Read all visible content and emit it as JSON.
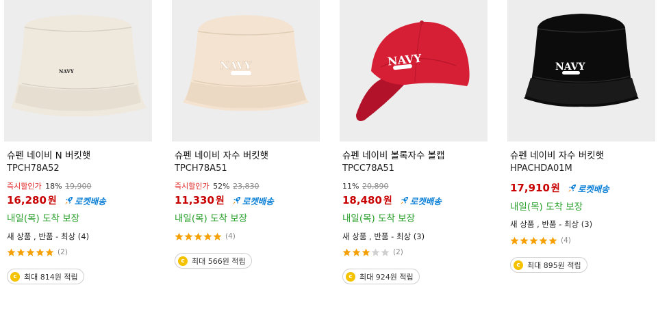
{
  "colors": {
    "discount_red": "#e02020",
    "price_red": "#c80000",
    "rocket_blue": "#0a7fd6",
    "delivery_green": "#28a02a",
    "star_orange": "#f5a000",
    "coin_yellow": "#f5c200"
  },
  "common": {
    "rocket_label": "로켓배송",
    "delivery_text": "내일(목) 도착 보장",
    "coin_symbol": "c",
    "discount_label": "즉시할인가",
    "price_unit": "원"
  },
  "products": [
    {
      "image_icon": "bucket-hat-cream-icon",
      "title": "슈펜 네이비 N 버킷햇",
      "code": "TPCH78A52",
      "discount_rate": "18%",
      "original_price": "19,900",
      "price": "16,280",
      "condition": "새 상품 , 반품 - 최상 (4)",
      "rating": 5,
      "rating_count": "(2)",
      "reward": "최대 814원 적립"
    },
    {
      "image_icon": "bucket-hat-beige-icon",
      "title": "슈펜 네이비 자수 버킷햇",
      "code": "TPCH78A51",
      "discount_rate": "52%",
      "original_price": "23,830",
      "price": "11,330",
      "rating": 5,
      "rating_count": "(4)",
      "reward": "최대 566원 적립"
    },
    {
      "image_icon": "ball-cap-red-icon",
      "title": "슈펜 네이비 볼록자수 볼캡",
      "code": "TPCC78A51",
      "discount_rate": "11%",
      "original_price": "20,890",
      "price": "18,480",
      "condition": "새 상품 , 반품 - 최상 (3)",
      "rating": 3,
      "rating_count": "(2)",
      "reward": "최대 924원 적립"
    },
    {
      "image_icon": "bucket-hat-black-icon",
      "title": "슈펜 네이비 자수 버킷햇",
      "code": "HPACHDA01M",
      "price": "17,910",
      "condition": "새 상품 , 반품 - 최상 (3)",
      "rating": 5,
      "rating_count": "(4)",
      "reward": "최대 895원 적립"
    }
  ]
}
